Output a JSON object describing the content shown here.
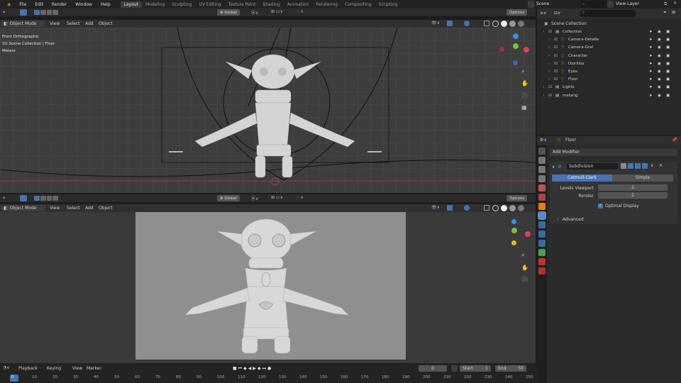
{
  "topbar": {
    "menus": [
      "File",
      "Edit",
      "Render",
      "Window",
      "Help"
    ],
    "workspaces": [
      "Layout",
      "Modeling",
      "Sculpting",
      "UV Editing",
      "Texture Paint",
      "Shading",
      "Animation",
      "Rendering",
      "Compositing",
      "Scripting"
    ],
    "active_workspace": "Layout",
    "scene_label": "Scene",
    "view_layer_label": "View Layer",
    "search_placeholder": ""
  },
  "viewport_top": {
    "mode": "Object Mode",
    "menus": [
      "View",
      "Select",
      "Add",
      "Object"
    ],
    "transform": "Global",
    "options": "Options",
    "overlay_lines": [
      "Front Orthographic",
      "(0) Scene Collection | Floor",
      "Meters"
    ]
  },
  "viewport_bottom": {
    "mode": "Object Mode",
    "menus": [
      "View",
      "Select",
      "Add",
      "Object"
    ],
    "transform": "Global",
    "options": "Options"
  },
  "outliner": {
    "root": "Scene Collection",
    "items": [
      {
        "label": "Collection",
        "depth": 1
      },
      {
        "label": "Camera-Detalle",
        "depth": 2
      },
      {
        "label": "Camera-Gral",
        "depth": 2
      },
      {
        "label": "Character",
        "depth": 2
      },
      {
        "label": "Diorillos",
        "depth": 2
      },
      {
        "label": "Eyes",
        "depth": 2
      },
      {
        "label": "Floor",
        "depth": 2
      },
      {
        "label": "Lights",
        "depth": 1
      },
      {
        "label": "metarig",
        "depth": 1
      }
    ]
  },
  "properties": {
    "object_name": "Floor",
    "add_modifier": "Add Modifier",
    "modifier_name": "Subdivision",
    "catmull": "Catmull-Clark",
    "simple": "Simple",
    "levels_viewport_label": "Levels Viewport",
    "levels_viewport_value": "2",
    "render_label": "Render",
    "render_value": "2",
    "optimal_display": "Optimal Display",
    "advanced": "Advanced"
  },
  "timeline": {
    "menus": [
      "Playback",
      "Keying",
      "View",
      "Marker"
    ],
    "current_frame": "0",
    "start_label": "Start",
    "start_value": "1",
    "end_label": "End",
    "end_value": "50",
    "ruler": [
      "0",
      "10",
      "20",
      "30",
      "40",
      "50",
      "60",
      "70",
      "80",
      "90",
      "100",
      "110",
      "120",
      "130",
      "140",
      "150",
      "160",
      "170",
      "180",
      "190",
      "200",
      "210",
      "220",
      "230",
      "240",
      "250"
    ]
  },
  "colors": {
    "accent": "#4772b3",
    "x_axis": "#e04050",
    "y_axis": "#7cc040",
    "z_axis": "#3a8fe0",
    "modifier_wrench": "#4a8ed8"
  }
}
